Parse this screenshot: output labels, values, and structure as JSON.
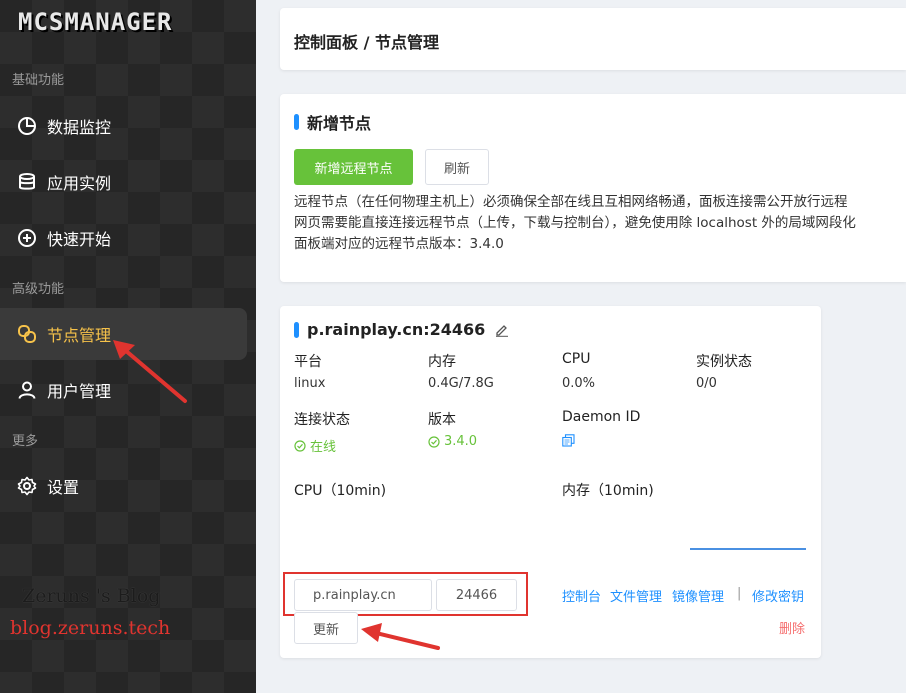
{
  "sidebar": {
    "logo": "MCSMANAGER",
    "groups": [
      {
        "title": "基础功能"
      },
      {
        "title": "高级功能"
      },
      {
        "title": "更多"
      }
    ],
    "items": [
      {
        "label": "数据监控",
        "icon": "pie-chart-icon"
      },
      {
        "label": "应用实例",
        "icon": "database-icon"
      },
      {
        "label": "快速开始",
        "icon": "plus-circle-icon"
      },
      {
        "label": "节点管理",
        "icon": "node-link-icon",
        "active": true
      },
      {
        "label": "用户管理",
        "icon": "user-icon"
      },
      {
        "label": "设置",
        "icon": "gear-icon"
      }
    ],
    "watermark_line1": "Zeruns 's Blog",
    "watermark_line2": "blog.zeruns.tech"
  },
  "breadcrumb": "控制面板 / 节点管理",
  "add_node": {
    "title": "新增节点",
    "add_button": "新增远程节点",
    "refresh_button": "刷新",
    "desc_lines": [
      "远程节点（在任何物理主机上）必须确保全部在线且互相网络畅通，面板连接需公开放行远程",
      "网页需要能直接连接远程节点（上传，下载与控制台），避免使用除 localhost 外的局域网段化",
      "面板端对应的远程节点版本：3.4.0"
    ]
  },
  "node": {
    "title": "p.rainplay.cn:24466",
    "fields": [
      {
        "label": "平台",
        "value": "linux"
      },
      {
        "label": "内存",
        "value": "0.4G/7.8G"
      },
      {
        "label": "CPU",
        "value": "0.0%"
      },
      {
        "label": "实例状态",
        "value": "0/0"
      }
    ],
    "conn_label": "连接状态",
    "conn_value": "在线",
    "version_label": "版本",
    "version_value": "3.4.0",
    "daemon_label": "Daemon ID",
    "cpu_chart_label": "CPU（10min)",
    "mem_chart_label": "内存（10min)",
    "ip_value": "p.rainplay.cn",
    "port_value": "24466",
    "update_button": "更新",
    "links": {
      "console": "控制台",
      "files": "文件管理",
      "images": "镜像管理",
      "separator": "|",
      "change_key": "修改密钥",
      "delete": "删除"
    }
  },
  "colors": {
    "sidebar_bg": "#262626",
    "active_text": "#f6c24a",
    "accent_blue": "#1e90ff",
    "success_green": "#67c23a",
    "danger_red": "#f56c6c",
    "annotation_red": "#e0342f"
  }
}
